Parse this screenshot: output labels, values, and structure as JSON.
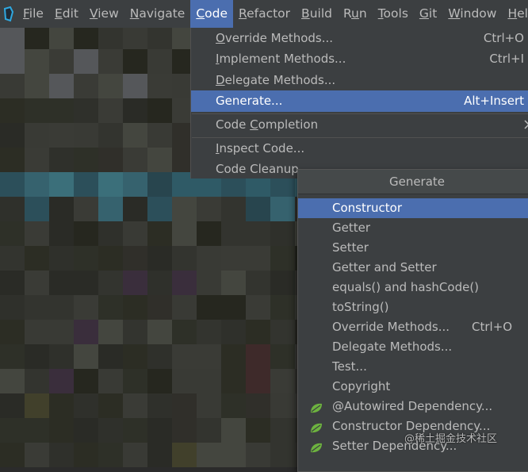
{
  "menubar": {
    "items": [
      {
        "pre": "",
        "mn": "F",
        "post": "ile"
      },
      {
        "pre": "",
        "mn": "E",
        "post": "dit"
      },
      {
        "pre": "",
        "mn": "V",
        "post": "iew"
      },
      {
        "pre": "",
        "mn": "N",
        "post": "avigate"
      },
      {
        "pre": "",
        "mn": "C",
        "post": "ode"
      },
      {
        "pre": "",
        "mn": "R",
        "post": "efactor"
      },
      {
        "pre": "",
        "mn": "B",
        "post": "uild"
      },
      {
        "pre": "R",
        "mn": "u",
        "post": "n"
      },
      {
        "pre": "",
        "mn": "T",
        "post": "ools"
      },
      {
        "pre": "",
        "mn": "G",
        "post": "it"
      },
      {
        "pre": "",
        "mn": "W",
        "post": "indow"
      },
      {
        "pre": "",
        "mn": "H",
        "post": "elp"
      }
    ]
  },
  "code_menu": {
    "items": [
      {
        "pre": "",
        "mn": "O",
        "post": "verride Methods...",
        "shortcut": "Ctrl+O"
      },
      {
        "pre": "",
        "mn": "I",
        "post": "mplement Methods...",
        "shortcut": "Ctrl+I"
      },
      {
        "pre": "",
        "mn": "D",
        "post": "elegate Methods...",
        "shortcut": ""
      },
      {
        "pre": "",
        "mn": "",
        "post": "Generate...",
        "shortcut": "Alt+Insert"
      },
      {
        "pre": "Code ",
        "mn": "C",
        "post": "ompletion",
        "shortcut": ""
      },
      {
        "pre": "",
        "mn": "I",
        "post": "nspect Code...",
        "shortcut": ""
      },
      {
        "pre": "",
        "mn": "",
        "post": "Code Cleanup...",
        "shortcut": ""
      }
    ]
  },
  "generate": {
    "title": "Generate",
    "items": [
      {
        "label": "Constructor",
        "shortcut": ""
      },
      {
        "label": "Getter",
        "shortcut": ""
      },
      {
        "label": "Setter",
        "shortcut": ""
      },
      {
        "label": "Getter and Setter",
        "shortcut": ""
      },
      {
        "label": "equals() and hashCode()",
        "shortcut": ""
      },
      {
        "label": "toString()",
        "shortcut": ""
      },
      {
        "label": "Override Methods...",
        "shortcut": "Ctrl+O"
      },
      {
        "label": "Delegate Methods...",
        "shortcut": ""
      },
      {
        "label": "Test...",
        "shortcut": ""
      },
      {
        "label": "Copyright",
        "shortcut": ""
      },
      {
        "label": "@Autowired Dependency...",
        "shortcut": ""
      },
      {
        "label": "Constructor Dependency...",
        "shortcut": ""
      },
      {
        "label": "Setter Dependency...",
        "shortcut": ""
      }
    ]
  },
  "watermark": "@稀土掘金技术社区",
  "colors": {
    "menu_bg": "#3c3f41",
    "selection": "#4b6eaf",
    "text": "#bbbbbb",
    "spring_leaf": "#6db33f"
  },
  "icons": {
    "app": "intellij-logo-icon",
    "submenu": "chevron-right-icon",
    "spring": "spring-leaf-icon"
  }
}
